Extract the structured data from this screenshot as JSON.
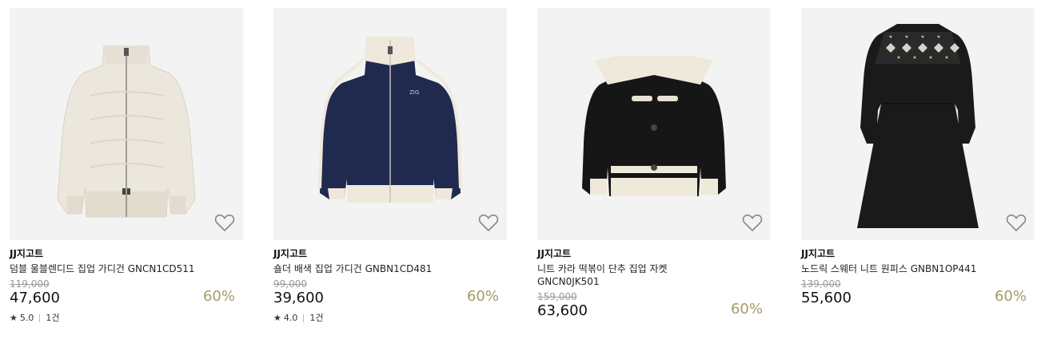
{
  "products": [
    {
      "brand": "JJ지고트",
      "name": "덤블 울블렌디드 집업 가디건 GNCN1CD511",
      "original_price": "119,000",
      "sale_price": "47,600",
      "discount": "60%",
      "rating": "5.0",
      "review_count": "1건",
      "image": "cream-zip-cardigan",
      "wish_icon": "heart-outline-icon"
    },
    {
      "brand": "JJ지고트",
      "name": "숄더 배색 집업 가디건 GNBN1CD481",
      "original_price": "99,000",
      "sale_price": "39,600",
      "discount": "60%",
      "rating": "4.0",
      "review_count": "1건",
      "image": "navy-track-cardigan",
      "wish_icon": "heart-outline-icon"
    },
    {
      "brand": "JJ지고트",
      "name": "니트 카라 떡볶이 단추 집업 자켓 GNCN0JK501",
      "original_price": "159,000",
      "sale_price": "63,600",
      "discount": "60%",
      "image": "black-toggle-jacket",
      "wish_icon": "heart-outline-icon"
    },
    {
      "brand": "JJ지고트",
      "name": "노드릭 스웨터 니트 원피스 GNBN1OP441",
      "original_price": "139,000",
      "sale_price": "55,600",
      "discount": "60%",
      "image": "black-nordic-dress",
      "wish_icon": "heart-outline-icon"
    }
  ],
  "colors": {
    "discount": "#a89a6c",
    "thumb_bg": "#f3f3f3",
    "original_price": "#999999"
  }
}
